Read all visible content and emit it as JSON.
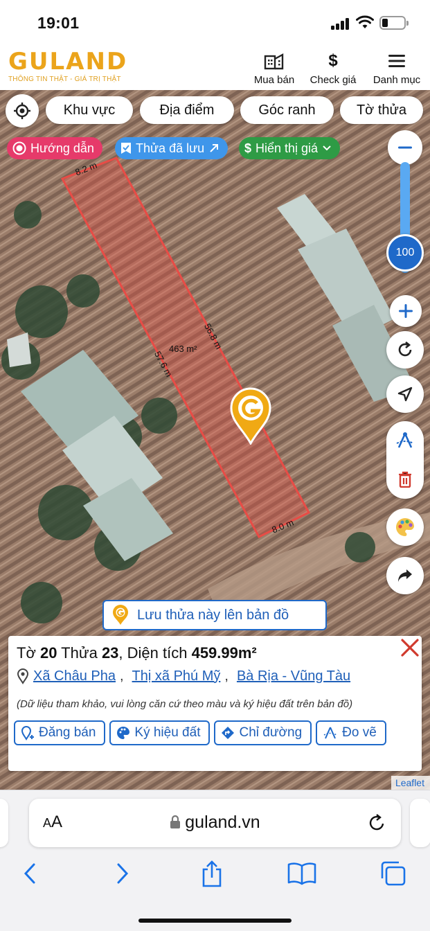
{
  "status": {
    "time": "19:01"
  },
  "header": {
    "logo_word": "GULAND",
    "logo_tagline": "THÔNG TIN THẬT - GIÁ TRỊ THẬT",
    "buttons": [
      {
        "label": "Mua bán",
        "icon": "building-icon"
      },
      {
        "label": "Check giá",
        "icon": "dollar-icon",
        "glyph": "$"
      },
      {
        "label": "Danh mục",
        "icon": "menu-icon"
      }
    ]
  },
  "filters": [
    "Khu vực",
    "Địa điểm",
    "Góc ranh",
    "Tờ thửa"
  ],
  "chips": {
    "guide": "Hướng dẫn",
    "saved": "Thửa đã lưu",
    "price": "Hiển thị giá",
    "price_symbol": "$"
  },
  "zoom": {
    "level": "100",
    "fraction": 0.55
  },
  "parcel": {
    "area_label": "463 m²",
    "edges": [
      "8.2 m",
      "56.8 m",
      "57.6 m",
      "8.0 m"
    ],
    "outline_color": "#e84c46"
  },
  "watermark": "G",
  "save_banner": "Lưu thửa này lên bản đồ",
  "card": {
    "to_prefix": "Tờ ",
    "to_value": "20",
    "thua_prefix": " Thửa ",
    "thua_value": "23",
    "area_prefix": ", Diện tích ",
    "area_value": "459.99m²",
    "address": [
      "Xã Châu Pha",
      "Thị xã Phú Mỹ",
      "Bà Rịa - Vũng Tàu"
    ],
    "address_sep": ",",
    "note": "(Dữ liệu tham khảo, vui lòng căn cứ theo màu và ký hiệu đất trên bản đồ)",
    "actions": [
      "Đăng bán",
      "Ký hiệu đất",
      "Chỉ đường",
      "Đo vẽ"
    ]
  },
  "attribution": "Leaflet",
  "browser": {
    "aa_small": "A",
    "aa_big": "A",
    "url": "guland.vn"
  },
  "colors": {
    "brand": "#eba41b",
    "primary_blue": "#1f69c9",
    "chip_pink": "#e63a6a",
    "chip_blue": "#3f96ea",
    "chip_green": "#2e9b45"
  }
}
